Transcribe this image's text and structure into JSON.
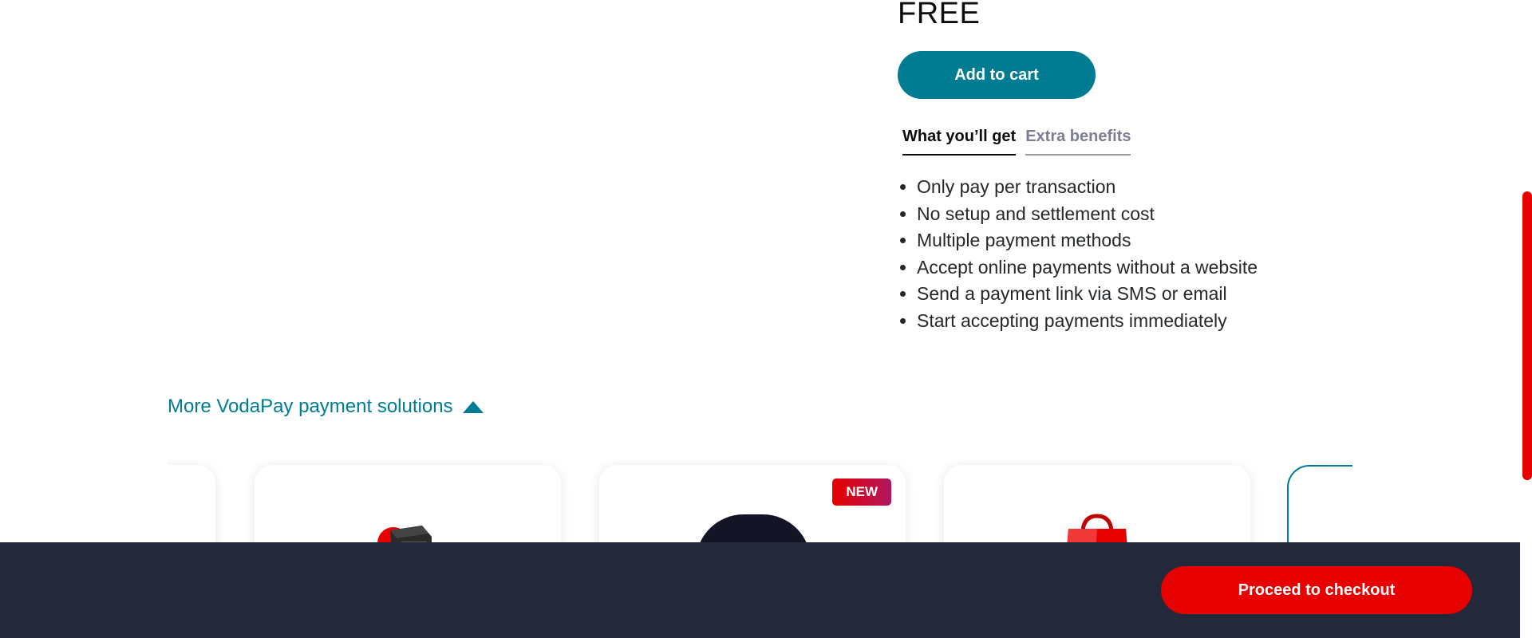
{
  "product": {
    "price": "FREE",
    "add_to_cart_label": "Add to cart"
  },
  "tabs": [
    {
      "label": "What you’ll get",
      "active": true
    },
    {
      "label": "Extra benefits",
      "active": false
    }
  ],
  "benefits": [
    "Only pay per transaction",
    "No setup and settlement cost",
    "Multiple payment methods",
    "Accept online payments without a website",
    "Send a payment link via SMS or email",
    "Start accepting payments immediately"
  ],
  "more_solutions": {
    "label": "More VodaPay payment solutions",
    "icon": "triangle-up-icon",
    "cards": [
      {
        "image": "card-terminal-image"
      },
      {
        "image": "app-logo-image",
        "badge": "NEW"
      },
      {
        "image": "shopping-bag-image"
      }
    ]
  },
  "footer": {
    "checkout_label": "Proceed to checkout"
  },
  "colors": {
    "teal": "#007c92",
    "red": "#e60000",
    "footer_bg": "#23283b"
  }
}
